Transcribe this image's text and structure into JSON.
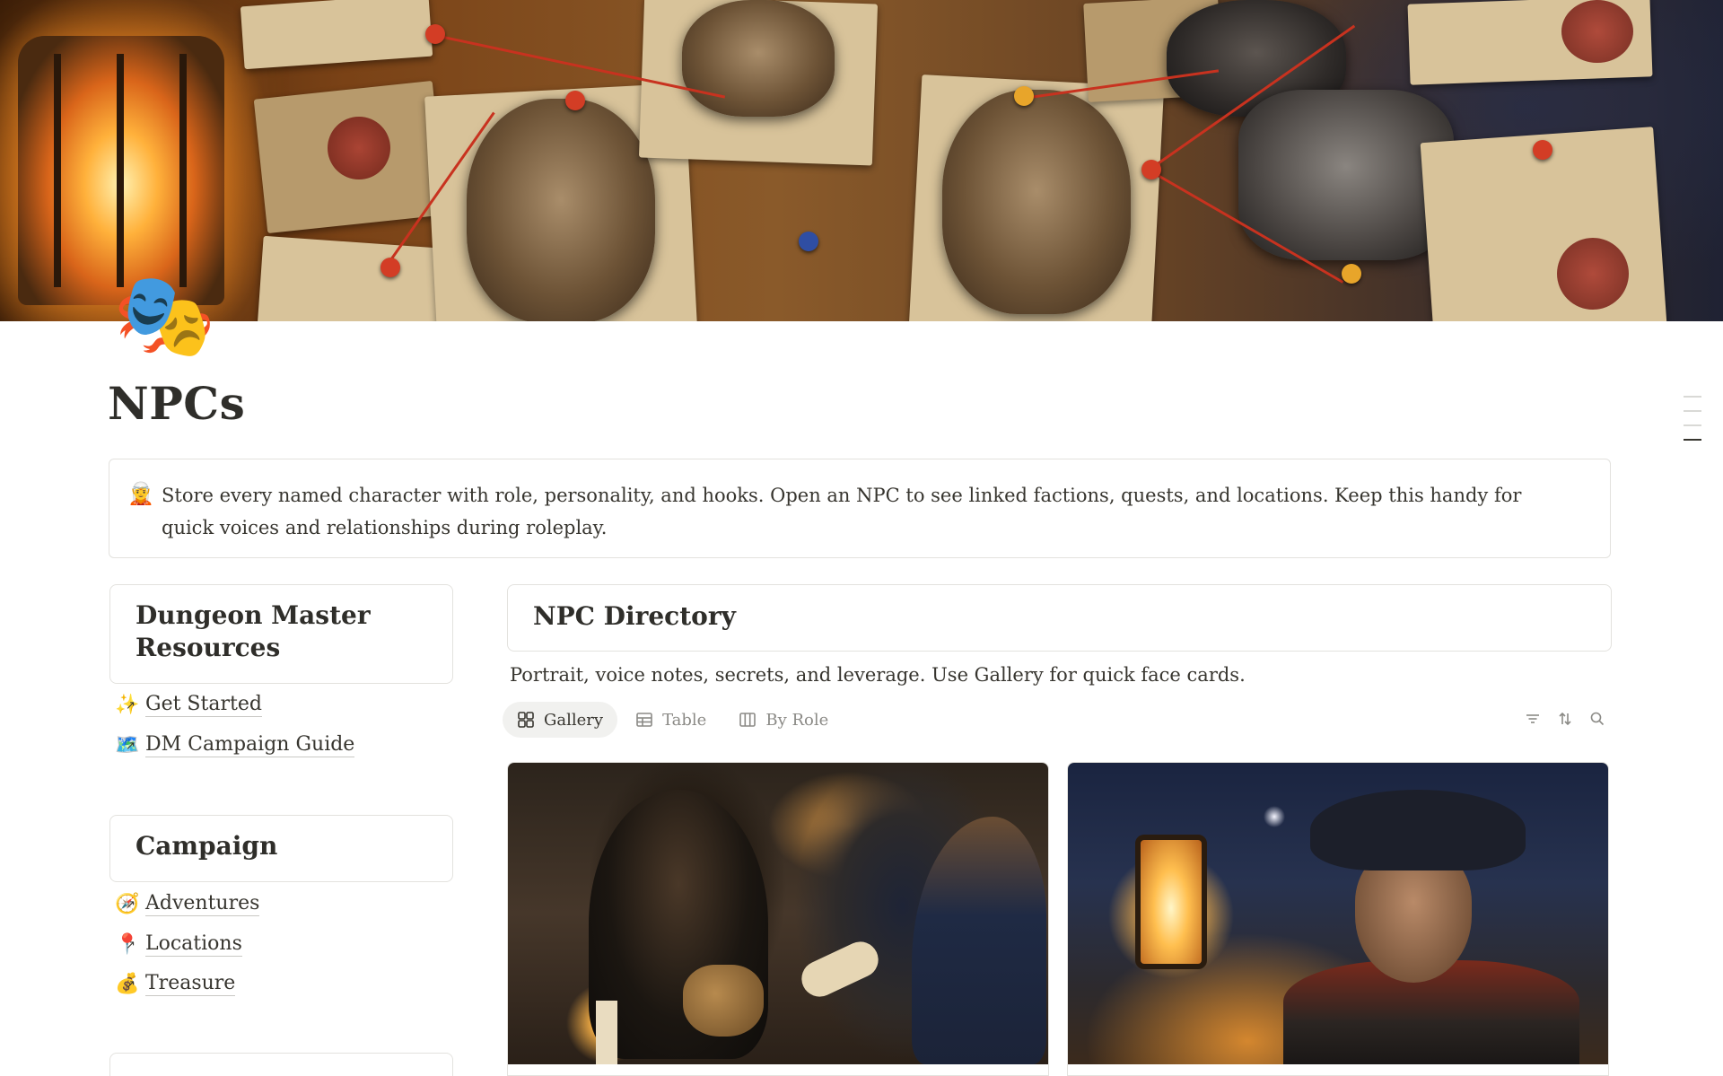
{
  "page": {
    "icon": "🎭",
    "title": "NPCs"
  },
  "callout": {
    "icon": "🧝",
    "text": "Store every named character with role, personality, and hooks. Open an NPC to see linked factions, quests, and locations. Keep this handy for quick voices and relationships during roleplay."
  },
  "sidebar": {
    "sections": [
      {
        "title": "Dungeon Master Resources",
        "links": [
          {
            "icon": "✨",
            "label": "Get Started"
          },
          {
            "icon": "🗺️",
            "label": "DM Campaign Guide"
          }
        ]
      },
      {
        "title": "Campaign",
        "links": [
          {
            "icon": "🧭",
            "label": "Adventures"
          },
          {
            "icon": "📍",
            "label": "Locations"
          },
          {
            "icon": "💰",
            "label": "Treasure"
          }
        ]
      }
    ]
  },
  "directory": {
    "title": "NPC Directory",
    "description": "Portrait, voice notes, secrets, and leverage. Use Gallery for quick face cards.",
    "views": [
      {
        "label": "Gallery",
        "icon": "gallery-icon",
        "active": true
      },
      {
        "label": "Table",
        "icon": "table-icon",
        "active": false
      },
      {
        "label": "By Role",
        "icon": "board-icon",
        "active": false
      }
    ],
    "tools": [
      "filter-icon",
      "sort-icon",
      "search-icon"
    ],
    "cards": [
      {
        "image": "hooded-informant-tavern-portrait"
      },
      {
        "image": "harbor-captain-lantern-portrait"
      }
    ]
  },
  "colors": {
    "text": "#37352f",
    "muted": "#8b8a86",
    "border": "#e3e2de",
    "active_view_bg": "#f1f1ef"
  }
}
